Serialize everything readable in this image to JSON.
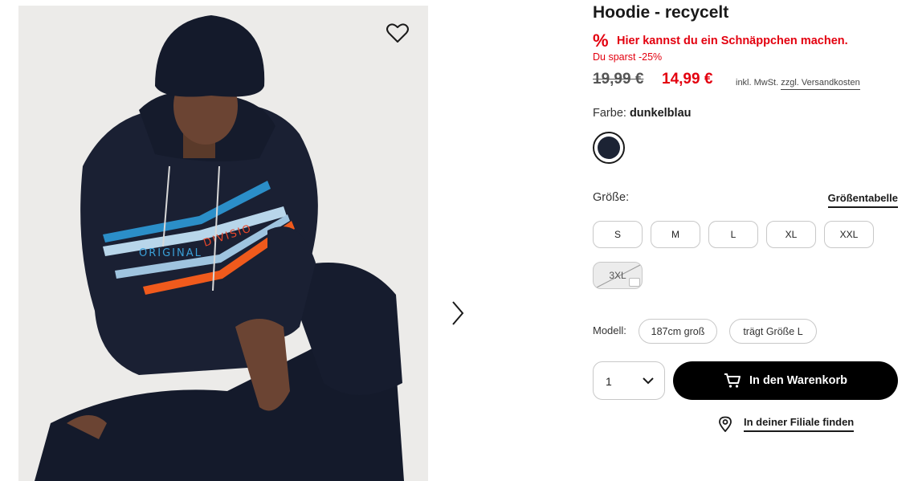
{
  "product": {
    "title": "Hoodie - recycelt",
    "deal_icon": "%",
    "deal_text": "Hier kannst du ein Schnäppchen machen.",
    "savings_text": "Du sparst -25%",
    "old_price": "19,99 €",
    "new_price": "14,99 €",
    "tax_note": "inkl. MwSt.",
    "shipping_link": "zzgl. Versandkosten",
    "image_alt": "Model in dark blue hoodie with stripe print"
  },
  "color": {
    "label": "Farbe:",
    "selected": "dunkelblau",
    "swatch_hex": "#1c2334"
  },
  "size": {
    "label": "Größe:",
    "chart_link": "Größentabelle",
    "options": [
      {
        "label": "S",
        "available": true
      },
      {
        "label": "M",
        "available": true
      },
      {
        "label": "L",
        "available": true
      },
      {
        "label": "XL",
        "available": true
      },
      {
        "label": "XXL",
        "available": true
      },
      {
        "label": "3XL",
        "available": false
      }
    ]
  },
  "model": {
    "label": "Modell:",
    "height": "187cm groß",
    "wears": "trägt Größe L"
  },
  "cart": {
    "quantity": "1",
    "button_label": "In den Warenkorb"
  },
  "store": {
    "link_label": "In deiner Filiale finden"
  },
  "colors": {
    "accent_red": "#e3000f",
    "button_black": "#000000"
  },
  "icons": {
    "wishlist": "heart-icon",
    "next": "chevron-right-icon",
    "quantity": "chevron-down-icon",
    "cart": "cart-icon",
    "store": "map-pin-icon",
    "notify": "mail-icon"
  }
}
